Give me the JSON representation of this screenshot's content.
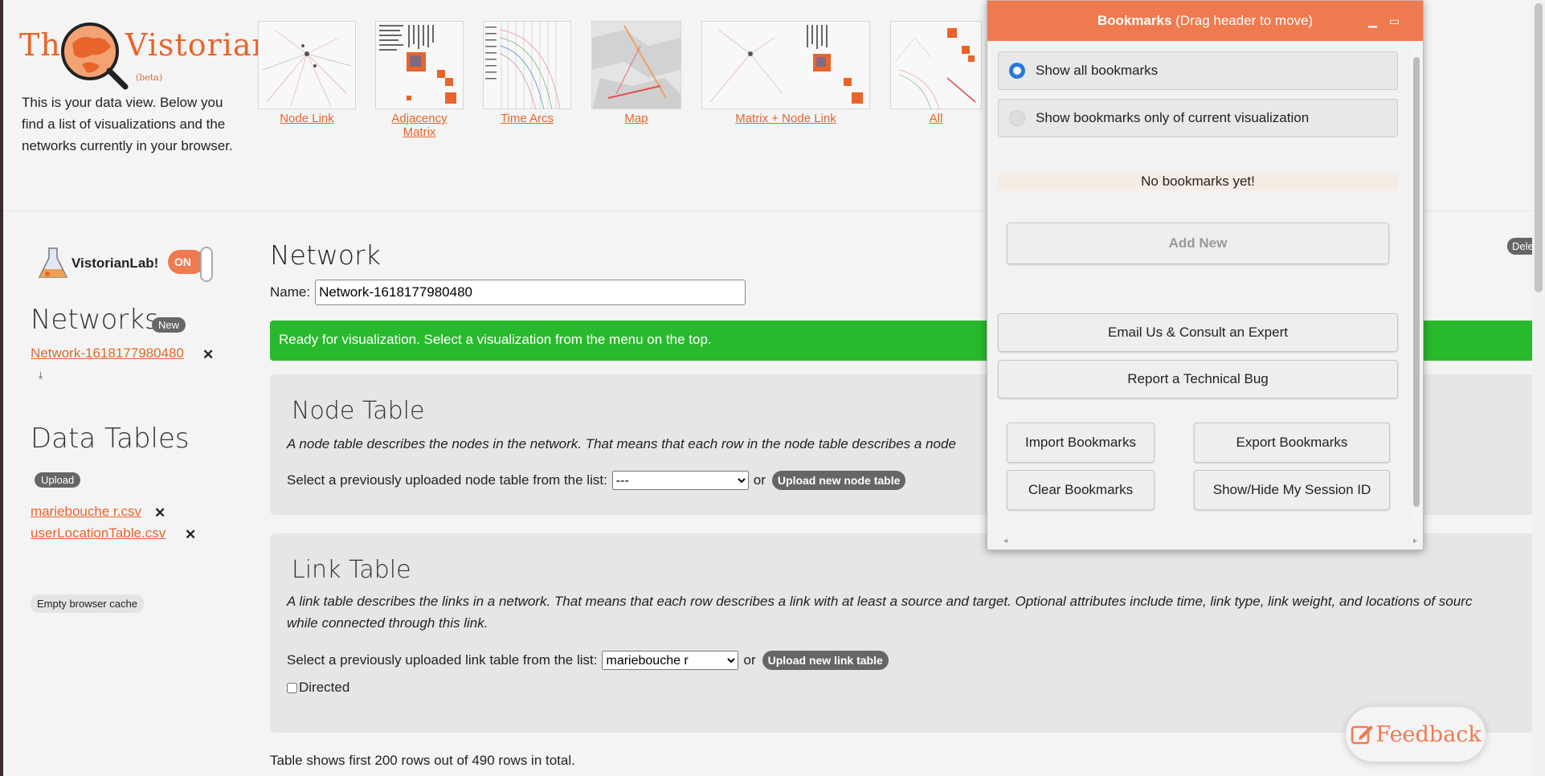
{
  "brand": {
    "logo_text_left": "The",
    "logo_text_right": "Vistorian",
    "beta": "(beta)",
    "intro": "This is your data view. Below you find a list of visualizations and the networks currently in your browser."
  },
  "visualizations": [
    {
      "label": "Node Link"
    },
    {
      "label": "Adjacency Matrix"
    },
    {
      "label": "Time Arcs"
    },
    {
      "label": "Map"
    },
    {
      "label": "Matrix + Node Link"
    },
    {
      "label": "All"
    }
  ],
  "lab": {
    "label": "VistorianLab!",
    "toggle": "ON"
  },
  "sidebar": {
    "networks_title": "Networks",
    "new_button": "New",
    "networks": [
      {
        "label": "Network-1618177980480",
        "remove": "✕"
      }
    ],
    "download_icon": "⤓",
    "data_tables_title": "Data Tables",
    "upload_button": "Upload",
    "tables": [
      {
        "label": "mariebouche r.csv",
        "remove": "✕"
      },
      {
        "label": "userLocationTable.csv",
        "remove": "✕"
      }
    ],
    "cache_button": "Empty browser cache"
  },
  "main": {
    "title": "Network",
    "name_label": "Name:",
    "name_value": "Network-1618177980480",
    "ready_message": "Ready for visualization. Select a visualization from the menu on the top.",
    "delete_button": "Dele",
    "node_table": {
      "title": "Node Table",
      "desc": "A node table describes the nodes in the network. That means that each row in the node table describes a node",
      "select_label": "Select a previously uploaded node table from the list:",
      "select_value": "---",
      "or": "or",
      "upload_button": "Upload new node table"
    },
    "link_table": {
      "title": "Link Table",
      "desc_line1": "A link table describes the links in a network. That means that each row describes a link with at least a source and target. Optional attributes include time, link type, link weight, and locations of sourc",
      "desc_line2": "while connected through this link.",
      "select_label": "Select a previously uploaded link table from the list:",
      "select_value": "mariebouche r",
      "or": "or",
      "upload_button": "Upload new link table",
      "directed_label": "Directed",
      "directed_checked": false
    },
    "table_info": "Table shows first 200 rows out of 490 rows in total."
  },
  "bookmarks": {
    "title_bold": "Bookmarks",
    "title_rest": " (Drag header to move)",
    "minimize_icon": "▁",
    "maximize_icon": "▭",
    "radio_all": "Show all bookmarks",
    "radio_current": "Show bookmarks only of current visualization",
    "selected": "all",
    "empty": "No bookmarks yet!",
    "add_new": "Add New",
    "email": "Email Us & Consult an Expert",
    "report_bug": "Report a Technical Bug",
    "import": "Import Bookmarks",
    "export": "Export Bookmarks",
    "clear": "Clear Bookmarks",
    "session": "Show/Hide My Session ID"
  },
  "feedback": {
    "label": "Feedback",
    "icon": "edit-icon"
  },
  "colors": {
    "accent": "#ef7a4f",
    "link": "#e8642b",
    "ready": "#29b92c",
    "pill": "#666666"
  }
}
